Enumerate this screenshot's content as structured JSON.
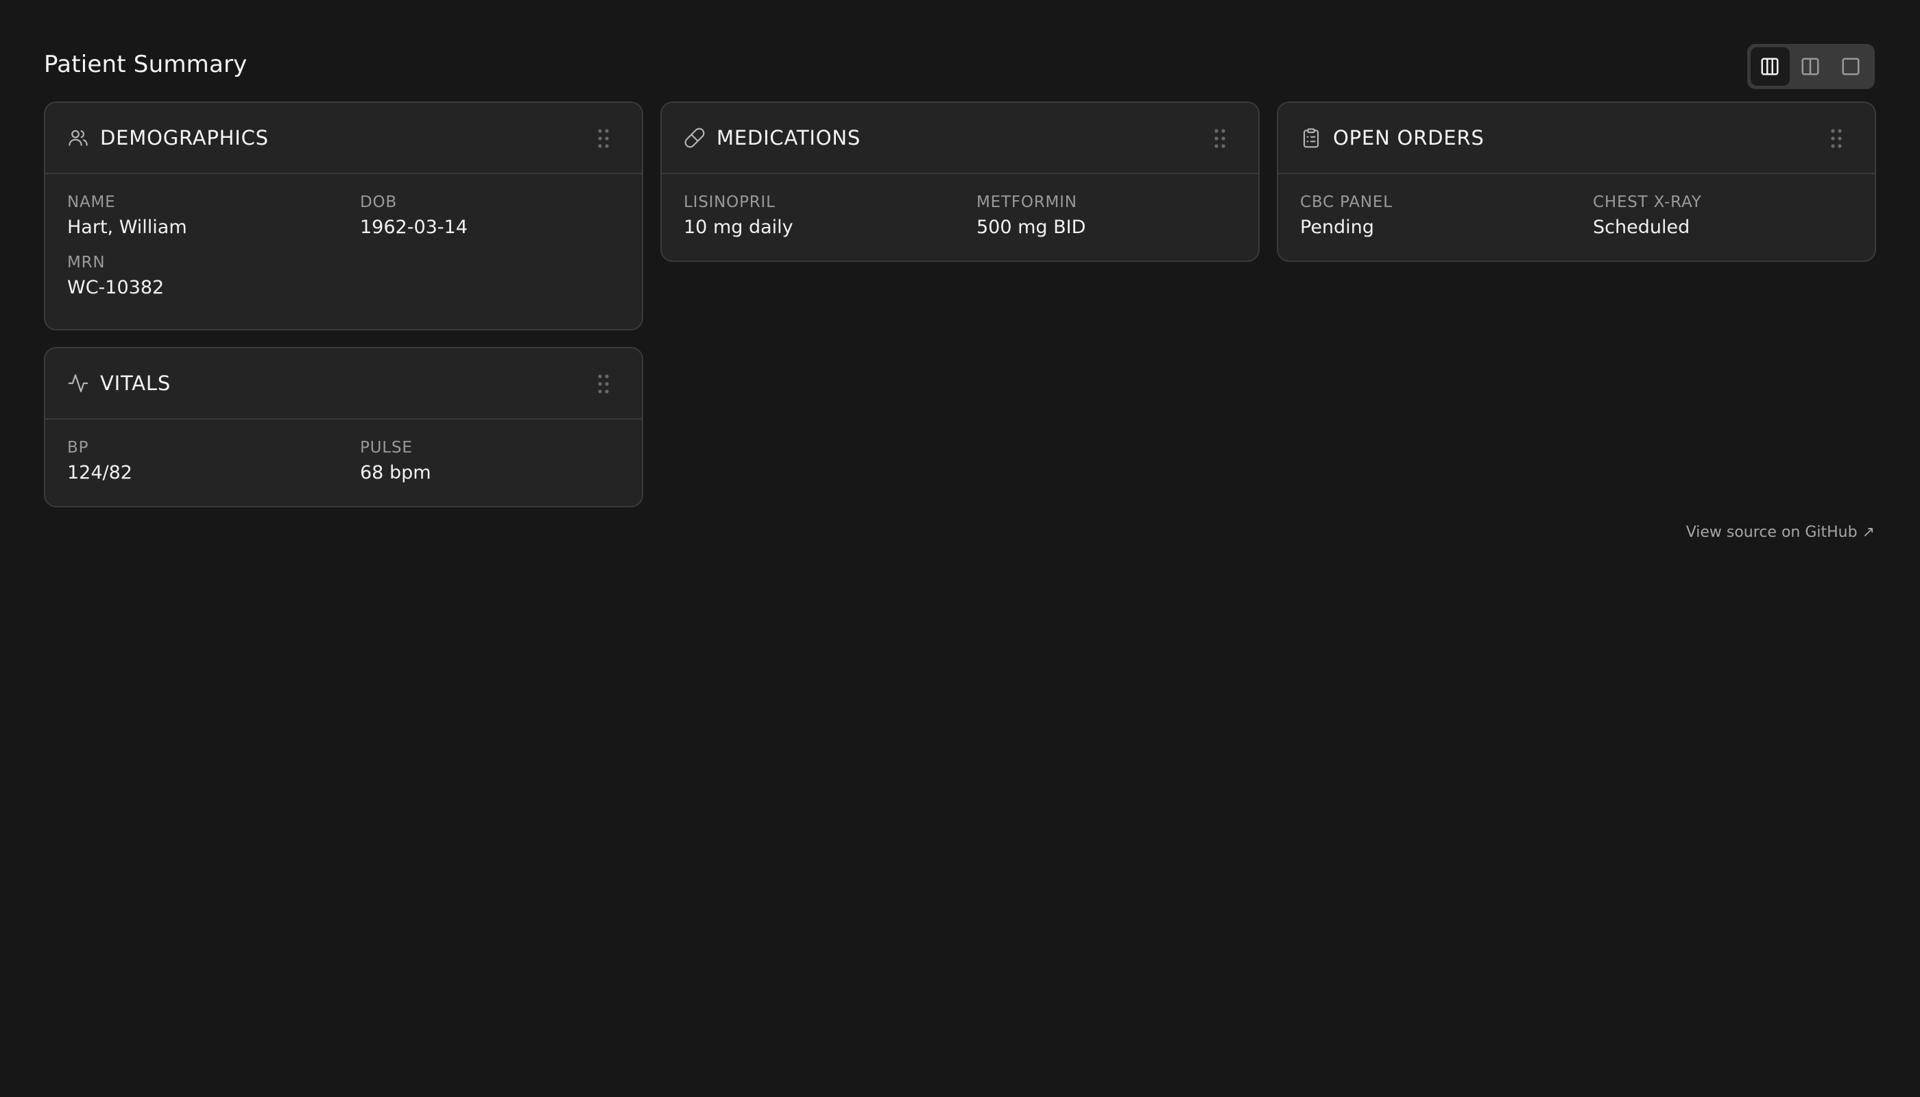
{
  "page": {
    "title": "Patient Summary"
  },
  "layout_toggle": {
    "options": [
      "three-column",
      "two-column",
      "single-column"
    ],
    "selected": "three-column"
  },
  "cards": {
    "demographics": {
      "title": "DEMOGRAPHICS",
      "icon": "users-icon",
      "fields": [
        {
          "label": "NAME",
          "value": "Hart, William"
        },
        {
          "label": "DOB",
          "value": "1962-03-14"
        },
        {
          "label": "MRN",
          "value": "WC-10382"
        }
      ]
    },
    "medications": {
      "title": "MEDICATIONS",
      "icon": "pill-icon",
      "fields": [
        {
          "label": "LISINOPRIL",
          "value": "10 mg daily"
        },
        {
          "label": "METFORMIN",
          "value": "500 mg BID"
        }
      ]
    },
    "open_orders": {
      "title": "OPEN ORDERS",
      "icon": "clipboard-icon",
      "fields": [
        {
          "label": "CBC PANEL",
          "value": "Pending"
        },
        {
          "label": "CHEST X-RAY",
          "value": "Scheduled"
        }
      ]
    },
    "vitals": {
      "title": "VITALS",
      "icon": "activity-icon",
      "fields": [
        {
          "label": "BP",
          "value": "124/82"
        },
        {
          "label": "PULSE",
          "value": "68 bpm"
        }
      ]
    }
  },
  "footer": {
    "link_text": "View source on GitHub ↗"
  },
  "colors": {
    "background": "#171717",
    "card": "#242424",
    "border": "#3a3a3a",
    "label": "#9a9a9a",
    "text": "#f2f2f2"
  }
}
